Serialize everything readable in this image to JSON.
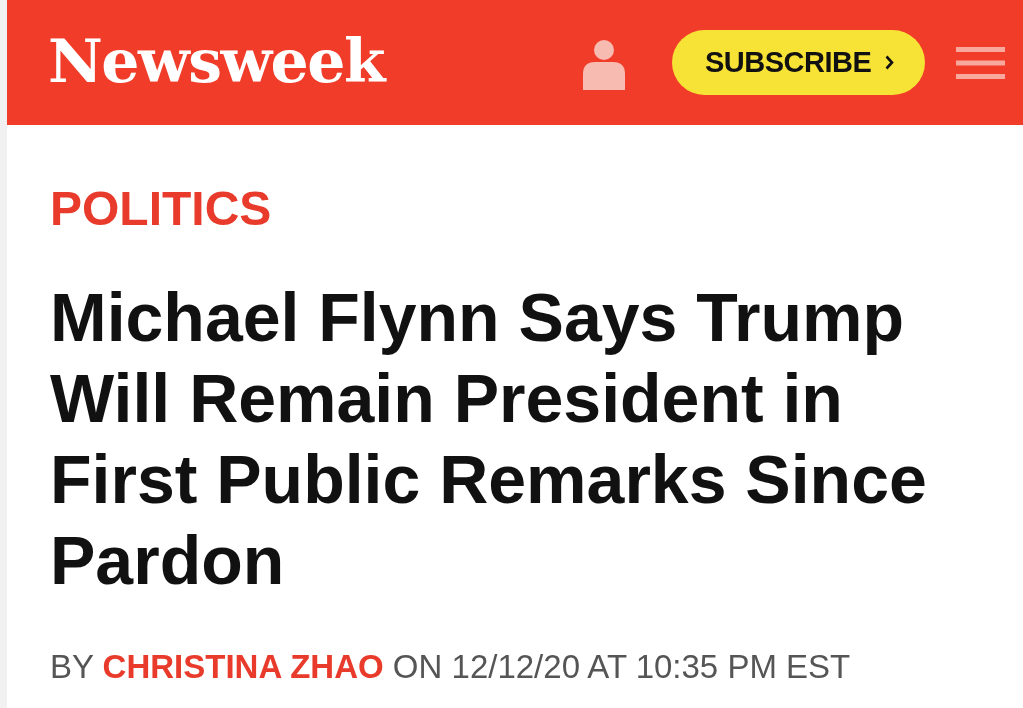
{
  "header": {
    "logo": "Newsweek",
    "subscribe_button": {
      "label": "SUBSCRIBE"
    }
  },
  "article": {
    "category": "POLITICS",
    "headline": "Michael Flynn Says Trump Will Remain President in First Public Remarks Since Pardon",
    "byline": {
      "prefix": "BY",
      "author": "CHRISTINA ZHAO",
      "suffix": "ON 12/12/20 AT 10:35 PM EST"
    }
  }
}
